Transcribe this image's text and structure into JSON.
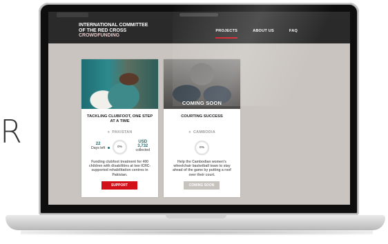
{
  "background_text": "R",
  "browser": {
    "tab_icon": "browser-tab-icon",
    "url_icon": "address-bar-icon"
  },
  "header": {
    "logo_line1": "INTERNATIONAL COMMITTEE",
    "logo_line2": "OF THE RED CROSS",
    "logo_line3": "CROWDFUNDING",
    "nav": [
      {
        "label": "PROJECTS",
        "active": true
      },
      {
        "label": "ABOUT US",
        "active": false
      },
      {
        "label": "FAQ",
        "active": false
      }
    ]
  },
  "cards": [
    {
      "title": "TACKLING CLUBFOOT, ONE STEP AT A TIME",
      "location": "PAKISTAN",
      "days_value": "22",
      "days_label": "Days left",
      "progress_label": "0%",
      "progress": 0,
      "amount_currency": "USD",
      "amount_value": "3,732",
      "amount_label": "collected",
      "description": "Funding clubfoot treatment for 400 children with disabilities at two ICRC-supported rehabilitation centres in Pakistan.",
      "button_label": "SUPPORT"
    },
    {
      "overlay": "COMING SOON",
      "title": "COURTING SUCCESS",
      "location": "CAMBODIA",
      "progress_label": "0%",
      "progress": 0,
      "description": "Help the Cambodian women's wheelchair basketball team to stay ahead of the game by putting a roof over their court.",
      "button_label": "COMING SOON"
    }
  ],
  "colors": {
    "brand_red": "#d1101a",
    "header_bg": "#2a2a2a",
    "page_bg": "#c9c4bf",
    "teal": "#1d6b6b"
  }
}
